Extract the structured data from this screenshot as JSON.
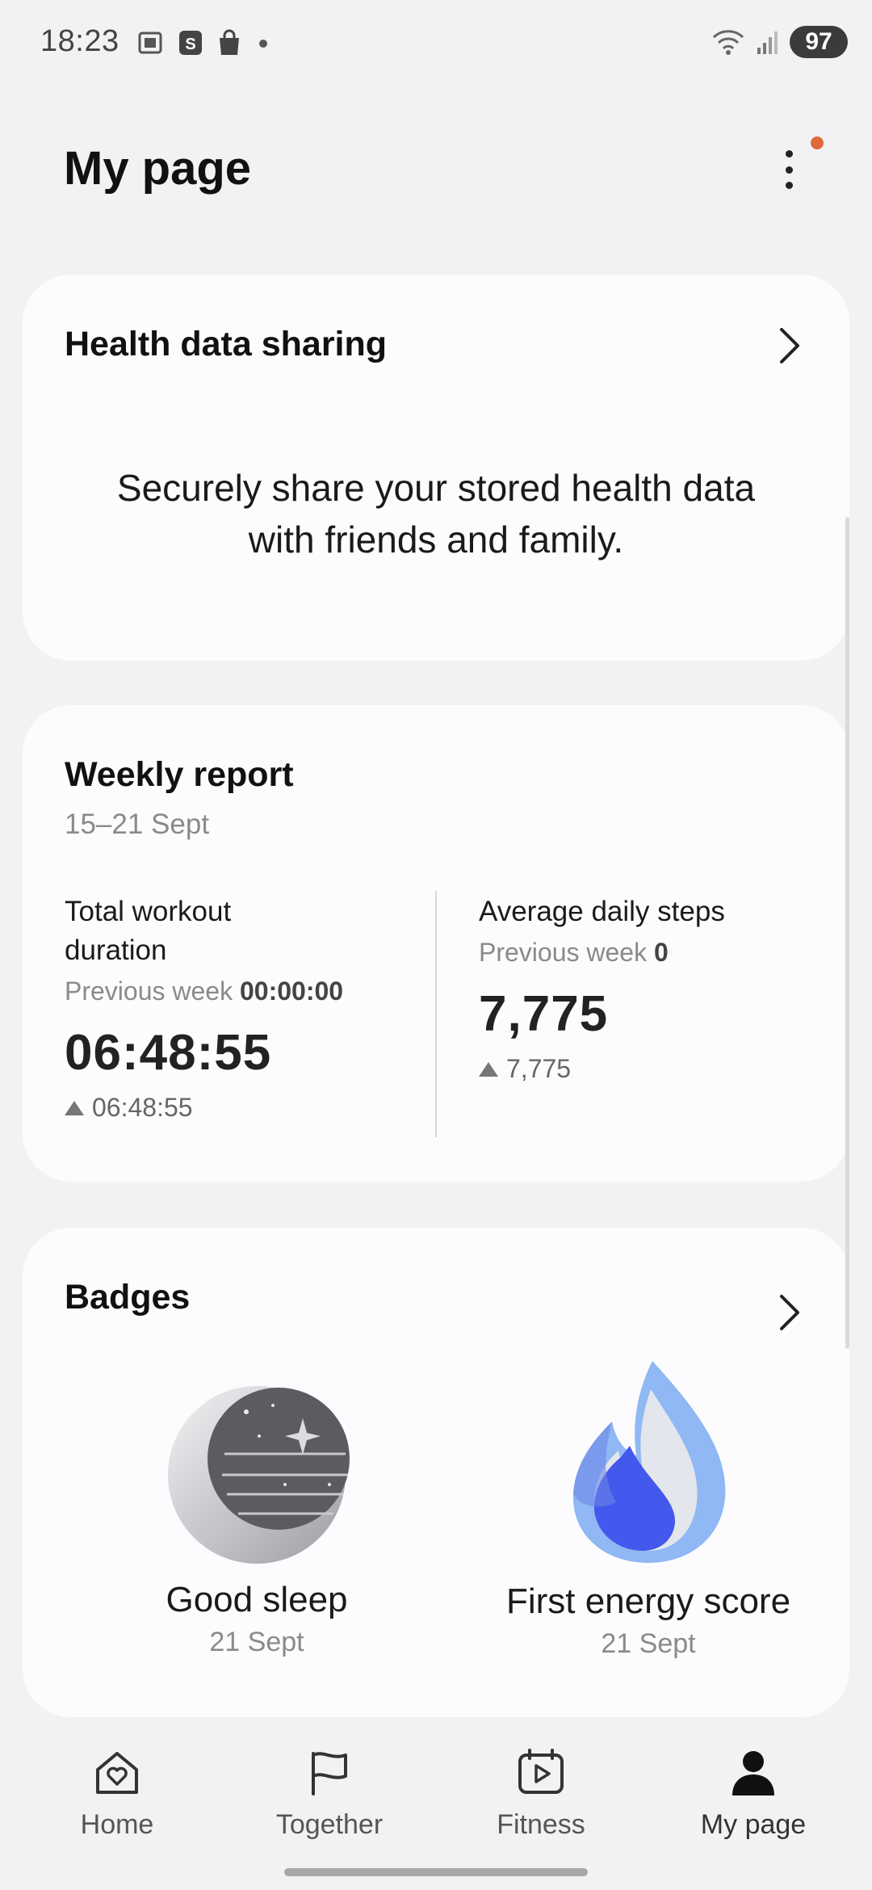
{
  "status_bar": {
    "time": "18:23",
    "battery": "97"
  },
  "header": {
    "title": "My page"
  },
  "health_sharing": {
    "title": "Health data sharing",
    "description": "Securely share your stored health data with friends and family."
  },
  "weekly_report": {
    "title": "Weekly report",
    "date_range": "15–21 Sept",
    "workout": {
      "label": "Total workout duration",
      "prev_label": "Previous week",
      "prev_value": "00:00:00",
      "value": "06:48:55",
      "delta": "06:48:55"
    },
    "steps": {
      "label": "Average daily steps",
      "prev_label": "Previous week",
      "prev_value": "0",
      "value": "7,775",
      "delta": "7,775"
    }
  },
  "badges": {
    "title": "Badges",
    "items": [
      {
        "name": "Good sleep",
        "date": "21 Sept",
        "icon": "moon-badge-icon"
      },
      {
        "name": "First energy score",
        "date": "21 Sept",
        "icon": "flame-badge-icon"
      }
    ]
  },
  "bottom_nav": {
    "items": [
      {
        "label": "Home",
        "icon": "home-heart-icon"
      },
      {
        "label": "Together",
        "icon": "flag-icon"
      },
      {
        "label": "Fitness",
        "icon": "calendar-play-icon"
      },
      {
        "label": "My page",
        "icon": "person-icon"
      }
    ],
    "active": "My page"
  },
  "colors": {
    "notification_dot": "#e0683a",
    "badge_blue": "#4a5cf0",
    "background": "#f2f2f4"
  }
}
